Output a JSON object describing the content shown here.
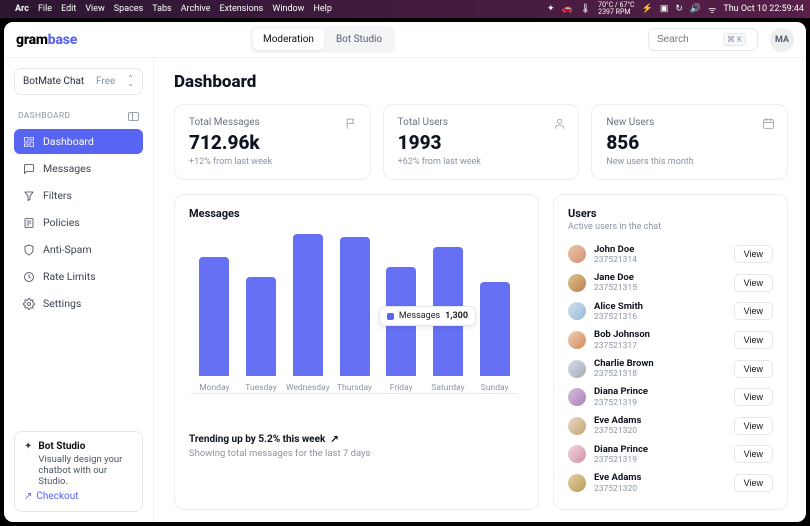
{
  "menubar": {
    "left_items": [
      "Arc",
      "File",
      "Edit",
      "View",
      "Spaces",
      "Tabs",
      "Archive",
      "Extensions",
      "Window",
      "Help"
    ],
    "temp_top": "70°C / 67°C",
    "temp_bottom": "2397 RPM",
    "datetime": "Thu Oct 10  22:59:44"
  },
  "topbar": {
    "logo_left": "gram",
    "logo_right": "base",
    "tabs": {
      "moderation": "Moderation",
      "botstudio": "Bot Studio"
    },
    "search_placeholder": "Search",
    "search_kbd": "⌘ K",
    "avatar_initials": "MA"
  },
  "sidebar": {
    "workspace": {
      "name": "BotMate Chat",
      "plan": "Free"
    },
    "section_label": "DASHBOARD",
    "items": [
      {
        "label": "Dashboard"
      },
      {
        "label": "Messages"
      },
      {
        "label": "Filters"
      },
      {
        "label": "Policies"
      },
      {
        "label": "Anti-Spam"
      },
      {
        "label": "Rate Limits"
      },
      {
        "label": "Settings"
      }
    ],
    "promo": {
      "title": "Bot Studio",
      "body": "Visually design your chatbot with our Studio.",
      "cta": "Checkout"
    }
  },
  "main": {
    "heading": "Dashboard",
    "stats": [
      {
        "label": "Total Messages",
        "value": "712.96k",
        "delta": "+12% from last week"
      },
      {
        "label": "Total Users",
        "value": "1993",
        "delta": "+62% from last week"
      },
      {
        "label": "New Users",
        "value": "856",
        "delta": "New users this month"
      }
    ],
    "chart": {
      "title": "Messages",
      "tooltip_label": "Messages",
      "tooltip_value": "1,300",
      "trend": "Trending up by 5.2% this week",
      "subtext": "Showing total messages for the last 7 days"
    },
    "users": {
      "title": "Users",
      "sub": "Active users in the chat",
      "view_label": "View",
      "list": [
        {
          "name": "John Doe",
          "id": "237521314"
        },
        {
          "name": "Jane Doe",
          "id": "237521315"
        },
        {
          "name": "Alice Smith",
          "id": "237521316"
        },
        {
          "name": "Bob Johnson",
          "id": "237521317"
        },
        {
          "name": "Charlie Brown",
          "id": "237521318"
        },
        {
          "name": "Diana Prince",
          "id": "237521319"
        },
        {
          "name": "Eve Adams",
          "id": "237521320"
        },
        {
          "name": "Diana Prince",
          "id": "237521319"
        },
        {
          "name": "Eve Adams",
          "id": "237521320"
        }
      ]
    }
  },
  "chart_data": {
    "type": "bar",
    "categories": [
      "Monday",
      "Tuesday",
      "Wednesday",
      "Thursday",
      "Friday",
      "Saturday",
      "Sunday"
    ],
    "values": [
      1200,
      1000,
      1500,
      1400,
      1100,
      1300,
      950
    ],
    "title": "Messages",
    "xlabel": "",
    "ylabel": "",
    "ylim": [
      0,
      1600
    ]
  }
}
